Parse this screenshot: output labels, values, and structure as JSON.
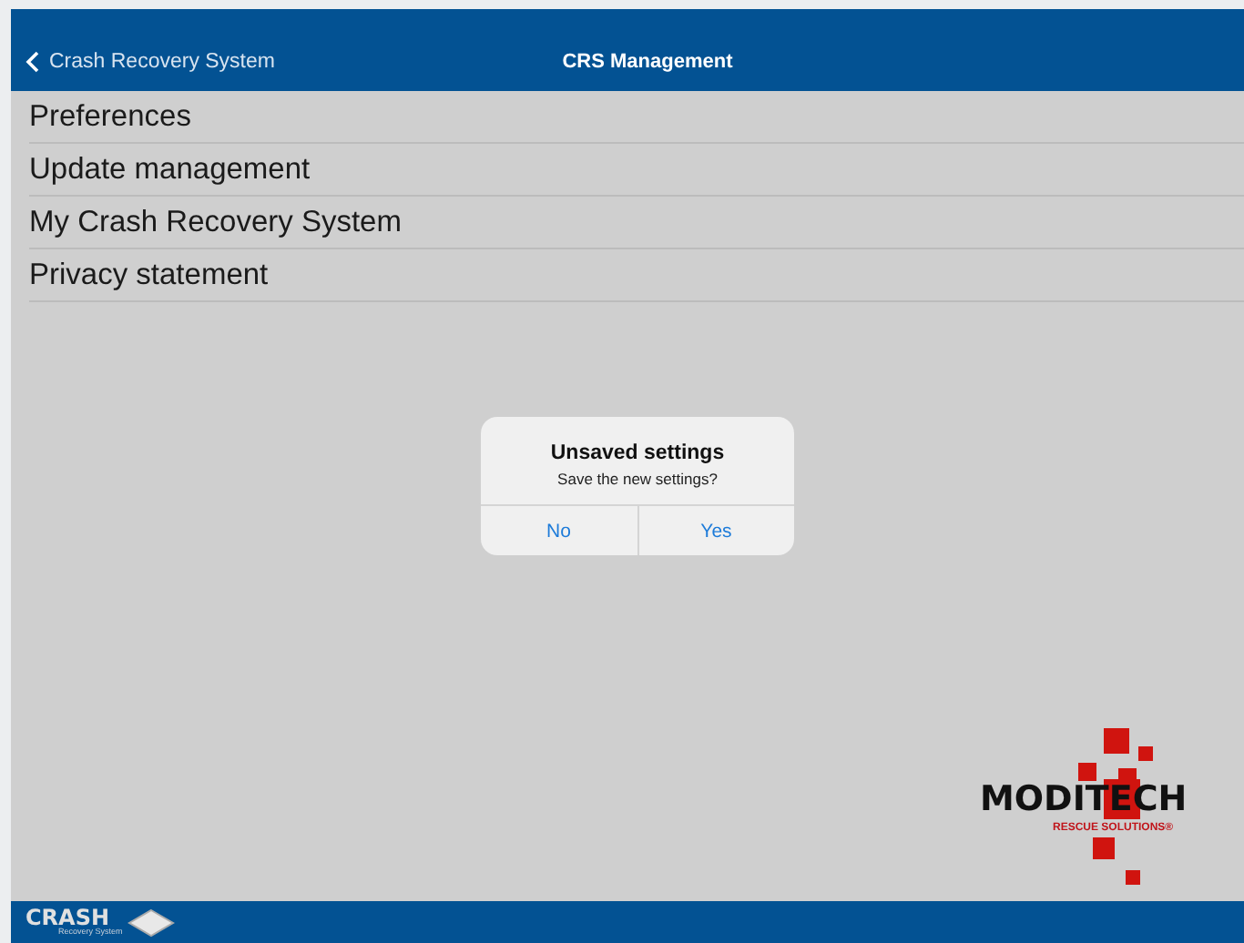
{
  "nav_bar": {
    "back_label": "Crash Recovery System",
    "title": "CRS Management"
  },
  "menu_items": [
    {
      "label": "Preferences"
    },
    {
      "label": "Update management"
    },
    {
      "label": "My Crash Recovery System"
    },
    {
      "label": "Privacy statement"
    }
  ],
  "dialog": {
    "title": "Unsaved settings",
    "message": "Save the new settings?",
    "buttons": [
      "No",
      "Yes"
    ]
  },
  "brand_logo": {
    "wordmark": "MODITECH",
    "tagline": "RESCUE SOLUTIONS®"
  },
  "footer": {
    "logo_word": "CRASH",
    "logo_subtitle": "Recovery System"
  }
}
